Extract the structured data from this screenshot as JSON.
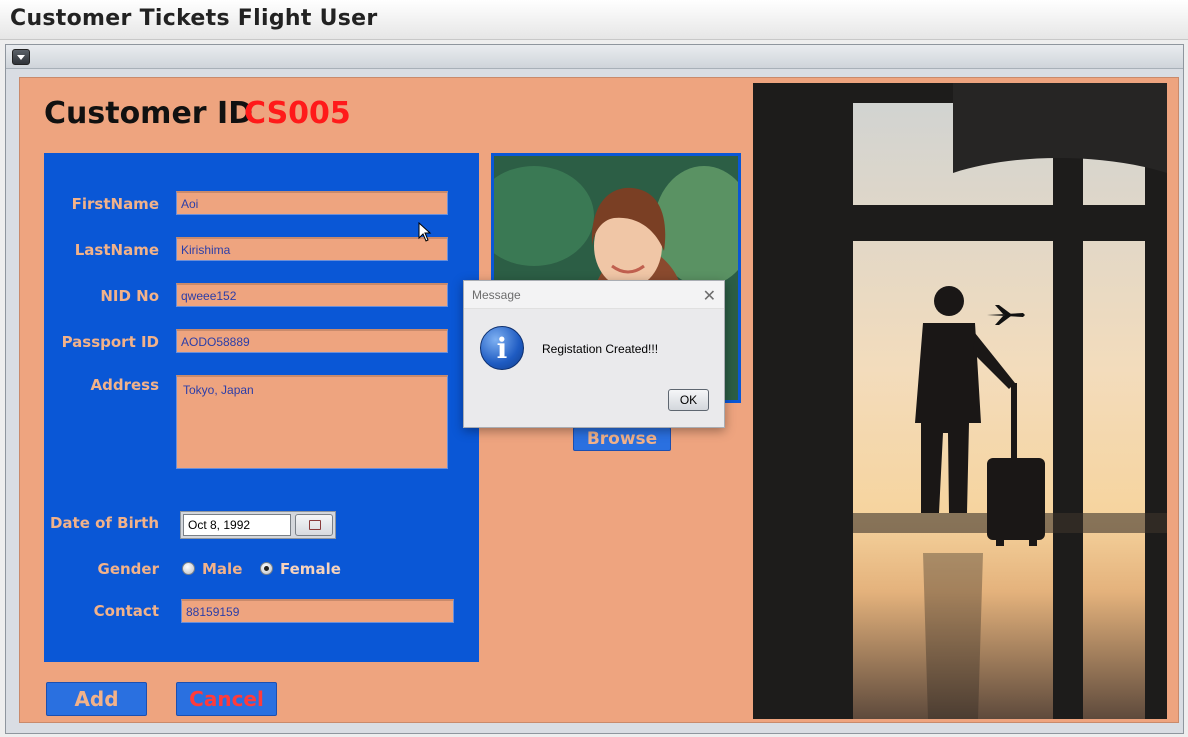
{
  "window": {
    "title": "Customer Tickets Flight User"
  },
  "header": {
    "label": "Customer ID",
    "id_value": "CS005"
  },
  "form": {
    "first_name": {
      "label": "FirstName",
      "value": "Aoi"
    },
    "last_name": {
      "label": "LastName",
      "value": "Kirishima"
    },
    "nid": {
      "label": "NID No",
      "value": "qweee152"
    },
    "passport": {
      "label": "Passport ID",
      "value": "AODO58889"
    },
    "address": {
      "label": "Address",
      "value": "Tokyo, Japan"
    },
    "dob": {
      "label": "Date of Birth",
      "value": "Oct 8, 1992"
    },
    "gender": {
      "label": "Gender",
      "options": [
        "Male",
        "Female"
      ],
      "selected": "Female"
    },
    "contact": {
      "label": "Contact",
      "value": "88159159"
    }
  },
  "photo": {
    "browse_label": "Browse"
  },
  "buttons": {
    "add": "Add",
    "cancel": "Cancel"
  },
  "dialog": {
    "title": "Message",
    "message": "Registation Created!!!",
    "ok": "OK"
  },
  "icons": [
    "system-menu-icon",
    "calendar-icon",
    "info-icon",
    "close-icon",
    "mouse-cursor-icon",
    "airplane-icon"
  ],
  "colors": {
    "panel": "#0a57d6",
    "background": "#eea47f",
    "label": "#f2b28a",
    "id": "#ff1a1a",
    "cancel": "#ff3b3b"
  }
}
